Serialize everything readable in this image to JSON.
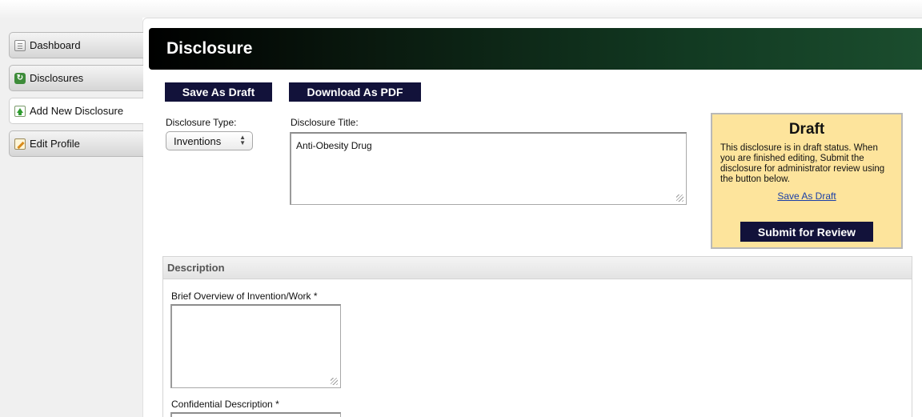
{
  "sidebar": {
    "items": [
      {
        "label": "Dashboard",
        "icon": "dashboard-icon"
      },
      {
        "label": "Disclosures",
        "icon": "disclosures-icon"
      },
      {
        "label": "Add New Disclosure",
        "icon": "add-icon",
        "active": true
      },
      {
        "label": "Edit Profile",
        "icon": "edit-icon"
      }
    ]
  },
  "header": {
    "title": "Disclosure"
  },
  "toolbar": {
    "save_draft_label": "Save As Draft",
    "download_pdf_label": "Download As PDF"
  },
  "form": {
    "type_label": "Disclosure Type:",
    "type_value": "Inventions",
    "title_label": "Disclosure Title:",
    "title_value": "Anti-Obesity Drug"
  },
  "draft_panel": {
    "heading": "Draft",
    "message": "This disclosure is in draft status. When you are finished editing, Submit the disclosure for administrator review using the button below.",
    "save_link": "Save As Draft",
    "submit_label": "Submit for Review"
  },
  "description": {
    "heading": "Description",
    "overview_label": "Brief Overview of Invention/Work *",
    "confidential_label": "Confidential Description *"
  },
  "colors": {
    "header_dark": "#000000",
    "header_green": "#1b4d2e",
    "button_navy": "#12123a",
    "draft_bg": "#fde49c",
    "link_blue": "#1a3fa8"
  }
}
